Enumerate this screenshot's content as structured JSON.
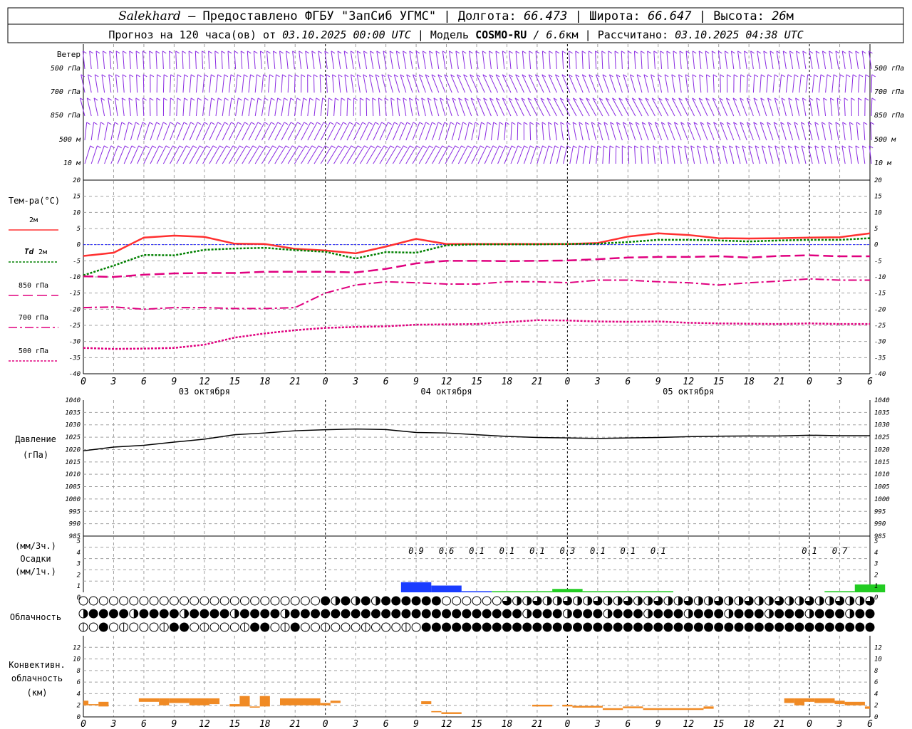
{
  "header": {
    "line1": {
      "station": "Salekhard",
      "dash": " – ",
      "provided": "Предоставлено ФГБУ \"ЗапСиб УГМС\"",
      "lon_label": "Долгота:",
      "lon_value": "66.473",
      "lat_label": "Широта:",
      "lat_value": "66.647",
      "alt_label": "Высота:",
      "alt_value": "26",
      "alt_unit": "м",
      "sep": "|"
    },
    "line2": {
      "forecast_label": "Прогноз на 120 часа(ов) от",
      "forecast_time": "03.10.2025 00:00 UTC",
      "model_label": "Модель",
      "model_name": "COSMO-RU",
      "model_res": "/ 6.6",
      "model_res_unit": "км",
      "calc_label": "Рассчитано:",
      "calc_time": "03.10.2025 04:38 UTC",
      "sep": "|"
    }
  },
  "colors": {
    "wind": "#8a2be2",
    "t2m": "#ff3030",
    "td2m": "#008000",
    "t850": "#e0007f",
    "t700": "#e0007f",
    "t500": "#e0007f",
    "pressure": "#000000",
    "precip_blue": "#1a3cff",
    "precip_green": "#22cc22",
    "conv": "#f08a24",
    "zero_line": "#2020ff",
    "grid": "#a0a0a0"
  },
  "time_axis": {
    "tick_labels": [
      "0",
      "3",
      "6",
      "9",
      "12",
      "15",
      "18",
      "21",
      "0",
      "3",
      "6",
      "9",
      "12",
      "15",
      "18",
      "21",
      "0",
      "3",
      "6",
      "9",
      "12",
      "15",
      "18",
      "21",
      "0",
      "3",
      "6"
    ],
    "dates": [
      "03 октября",
      "04 октября",
      "05 октября"
    ]
  },
  "wind_panel": {
    "title": "Ветер",
    "levels": [
      "500 гПа",
      "700 гПа",
      "850 гПа",
      "500 м",
      "10  м"
    ],
    "levels_right": [
      "500 гПа",
      "700 гПа",
      "850 гПа",
      "500 м",
      "10  м"
    ]
  },
  "temp_panel": {
    "ylabel": "Тем-ра(°С)",
    "legend": [
      {
        "name": "2м",
        "key": "t2m"
      },
      {
        "name_prefix": "Td",
        "name": "2м",
        "key": "td2m"
      },
      {
        "name": "850 гПа",
        "key": "t850"
      },
      {
        "name": "700 гПа",
        "key": "t700"
      },
      {
        "name": "500 гПа",
        "key": "t500"
      }
    ],
    "yticks": [
      "20",
      "15",
      "10",
      "5",
      "0",
      "-5",
      "-10",
      "-15",
      "-20",
      "-25",
      "-30",
      "-35",
      "-40"
    ]
  },
  "pressure_panel": {
    "ylabel_line1": "Давление",
    "ylabel_line2": "(гПа)",
    "yticks": [
      "1040",
      "1035",
      "1030",
      "1025",
      "1020",
      "1015",
      "1010",
      "1005",
      "1000",
      "995",
      "990",
      "985"
    ]
  },
  "precip_panel": {
    "label_line1": "(мм/3ч.)",
    "label_line2": "Осадки",
    "label_line3": "(мм/1ч.)",
    "yticks": [
      "5",
      "4",
      "3",
      "2",
      "1",
      "0"
    ],
    "annotations": [
      "0.9",
      "0.6",
      "0.1",
      "0.1",
      "0.1",
      "0.3",
      "0.1",
      "0.1",
      "0.1",
      "0.1",
      "0.7"
    ]
  },
  "cloud_panel": {
    "label": "Облачность"
  },
  "conv_panel": {
    "label_line1": "Конвективн.",
    "label_line2": "облачность",
    "label_line3": "(км)",
    "yticks": [
      "12",
      "10",
      "8",
      "6",
      "4",
      "2",
      "0"
    ]
  },
  "chart_data": [
    {
      "type": "line",
      "title": "Тем-ра(°С)",
      "x_hours": [
        0,
        3,
        6,
        9,
        12,
        15,
        18,
        21,
        24,
        27,
        30,
        33,
        36,
        39,
        42,
        45,
        48,
        51,
        54,
        57,
        60,
        63,
        66,
        69,
        72,
        75,
        78
      ],
      "ylim": [
        -40,
        20
      ],
      "series": [
        {
          "name": "2м",
          "values": [
            -3.5,
            -2.5,
            2.2,
            2.8,
            2.4,
            0.3,
            0.2,
            -1.3,
            -1.8,
            -2.7,
            -0.6,
            1.8,
            0.2,
            0.2,
            0.2,
            0.2,
            0.2,
            0.5,
            2.5,
            3.5,
            3.0,
            2.0,
            1.9,
            2.0,
            2.2,
            2.3,
            3.5
          ]
        },
        {
          "name": "Td 2м",
          "values": [
            -9.5,
            -6.5,
            -3.2,
            -3.3,
            -1.6,
            -1.2,
            -1.0,
            -1.7,
            -2.2,
            -4.3,
            -2.3,
            -2.5,
            -0.2,
            0.1,
            0.1,
            0.1,
            0.2,
            0.3,
            0.8,
            1.5,
            1.5,
            1.3,
            1.0,
            1.3,
            1.5,
            1.5,
            2.0
          ]
        },
        {
          "name": "850 гПа",
          "values": [
            -9.8,
            -10.0,
            -9.3,
            -8.9,
            -8.8,
            -8.8,
            -8.4,
            -8.4,
            -8.4,
            -8.6,
            -7.5,
            -5.8,
            -5.0,
            -5.0,
            -5.1,
            -5.0,
            -4.9,
            -4.5,
            -4.0,
            -3.8,
            -3.8,
            -3.6,
            -4.0,
            -3.5,
            -3.3,
            -3.6,
            -3.6
          ]
        },
        {
          "name": "700 гПа",
          "values": [
            -19.5,
            -19.3,
            -20.0,
            -19.5,
            -19.5,
            -19.8,
            -19.8,
            -19.5,
            -15.0,
            -12.5,
            -11.5,
            -11.8,
            -12.2,
            -12.2,
            -11.5,
            -11.5,
            -11.8,
            -11.0,
            -11.0,
            -11.5,
            -11.8,
            -12.5,
            -11.8,
            -11.3,
            -10.6,
            -11.0,
            -11.0
          ]
        },
        {
          "name": "500 гПа",
          "values": [
            -32.0,
            -32.3,
            -32.2,
            -32.0,
            -31.0,
            -28.8,
            -27.5,
            -26.5,
            -25.8,
            -25.5,
            -25.3,
            -24.8,
            -24.7,
            -24.6,
            -24.0,
            -23.4,
            -23.5,
            -23.8,
            -23.9,
            -23.8,
            -24.2,
            -24.4,
            -24.5,
            -24.6,
            -24.4,
            -24.6,
            -24.6
          ]
        }
      ]
    },
    {
      "type": "line",
      "title": "Давление",
      "x_hours": [
        0,
        3,
        6,
        9,
        12,
        15,
        18,
        21,
        24,
        27,
        30,
        33,
        36,
        39,
        42,
        45,
        48,
        51,
        54,
        57,
        60,
        63,
        66,
        69,
        72,
        75,
        78
      ],
      "ylim": [
        985,
        1040
      ],
      "series": [
        {
          "name": "Давление",
          "values": [
            1019.5,
            1021.0,
            1021.7,
            1023.0,
            1024.2,
            1026.0,
            1026.7,
            1027.6,
            1028.0,
            1028.3,
            1028.1,
            1026.9,
            1026.7,
            1026.0,
            1025.3,
            1024.9,
            1024.7,
            1024.5,
            1024.7,
            1024.9,
            1025.2,
            1025.4,
            1025.5,
            1025.5,
            1025.8,
            1025.6,
            1025.6
          ]
        }
      ]
    },
    {
      "type": "bar",
      "title": "Осадки",
      "ylim": [
        0,
        5
      ],
      "x_hours": [
        33,
        36,
        39,
        42,
        45,
        48,
        51,
        54,
        57,
        60,
        63,
        66,
        69,
        72,
        75,
        78
      ],
      "values": [
        0.9,
        0.6,
        0.1,
        0.1,
        0.1,
        0.3,
        0.1,
        0.1,
        0.1,
        0,
        0,
        0,
        0,
        0,
        0.1,
        0.7
      ]
    },
    {
      "type": "bar",
      "title": "Конвективн. облачность (км)",
      "ylim": [
        0,
        14
      ],
      "segments_hours": [
        {
          "x0": 0,
          "x1": 0.5,
          "base": 2.0,
          "top": 2.8
        },
        {
          "x0": 0.5,
          "x1": 1.5,
          "base": 2.0,
          "top": 2.2
        },
        {
          "x0": 1.5,
          "x1": 2.5,
          "base": 1.8,
          "top": 2.6
        },
        {
          "x0": 5.5,
          "x1": 7.5,
          "base": 2.6,
          "top": 3.2
        },
        {
          "x0": 7.5,
          "x1": 8.5,
          "base": 2.0,
          "top": 3.2
        },
        {
          "x0": 8.5,
          "x1": 10.5,
          "base": 2.4,
          "top": 3.2
        },
        {
          "x0": 10.5,
          "x1": 12.5,
          "base": 2.0,
          "top": 3.2
        },
        {
          "x0": 12.5,
          "x1": 13.5,
          "base": 2.2,
          "top": 3.2
        },
        {
          "x0": 14.5,
          "x1": 15.5,
          "base": 1.8,
          "top": 2.2
        },
        {
          "x0": 15.5,
          "x1": 16.5,
          "base": 1.8,
          "top": 3.6
        },
        {
          "x0": 16.5,
          "x1": 17.5,
          "base": 1.6,
          "top": 1.8
        },
        {
          "x0": 17.5,
          "x1": 18.5,
          "base": 1.8,
          "top": 3.6
        },
        {
          "x0": 19.5,
          "x1": 23.5,
          "base": 2.0,
          "top": 3.2
        },
        {
          "x0": 23.5,
          "x1": 24.5,
          "base": 2.0,
          "top": 2.4
        },
        {
          "x0": 24.5,
          "x1": 25.5,
          "base": 2.4,
          "top": 2.8
        },
        {
          "x0": 33.5,
          "x1": 34.5,
          "base": 2.2,
          "top": 2.7
        },
        {
          "x0": 34.5,
          "x1": 35.5,
          "base": 0.8,
          "top": 1.0
        },
        {
          "x0": 35.5,
          "x1": 37.5,
          "base": 0.5,
          "top": 0.8
        },
        {
          "x0": 44.5,
          "x1": 46.5,
          "base": 1.8,
          "top": 2.1
        },
        {
          "x0": 47.5,
          "x1": 48.5,
          "base": 1.8,
          "top": 2.1
        },
        {
          "x0": 48.5,
          "x1": 51.5,
          "base": 1.6,
          "top": 1.9
        },
        {
          "x0": 51.5,
          "x1": 53.5,
          "base": 1.2,
          "top": 1.5
        },
        {
          "x0": 53.5,
          "x1": 55.5,
          "base": 1.5,
          "top": 1.8
        },
        {
          "x0": 55.5,
          "x1": 61.5,
          "base": 1.2,
          "top": 1.5
        },
        {
          "x0": 61.5,
          "x1": 62.5,
          "base": 1.4,
          "top": 1.8
        },
        {
          "x0": 69.5,
          "x1": 70.5,
          "base": 2.4,
          "top": 3.2
        },
        {
          "x0": 70.5,
          "x1": 71.5,
          "base": 2.0,
          "top": 3.2
        },
        {
          "x0": 71.5,
          "x1": 72.5,
          "base": 2.6,
          "top": 3.2
        },
        {
          "x0": 72.5,
          "x1": 74.5,
          "base": 2.4,
          "top": 3.2
        },
        {
          "x0": 74.5,
          "x1": 75.5,
          "base": 2.2,
          "top": 2.8
        },
        {
          "x0": 75.5,
          "x1": 77.5,
          "base": 2.0,
          "top": 2.6
        },
        {
          "x0": 77.5,
          "x1": 78,
          "base": 1.4,
          "top": 1.8
        }
      ]
    }
  ]
}
